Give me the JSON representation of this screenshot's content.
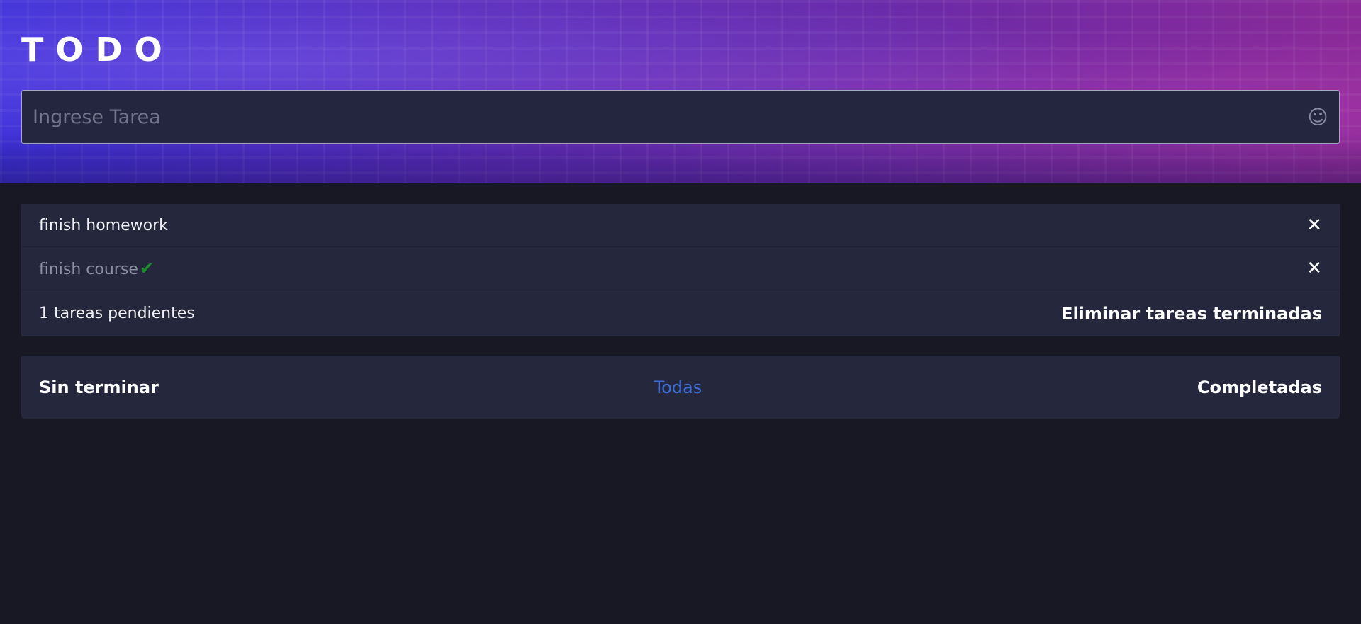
{
  "header": {
    "title": "TODO",
    "input_placeholder": "Ingrese Tarea",
    "emoji_icon": "smile-icon"
  },
  "todos": [
    {
      "text": "finish homework",
      "completed": false
    },
    {
      "text": "finish course",
      "completed": true
    }
  ],
  "footer": {
    "pending_text": "1 tareas pendientes",
    "clear_label": "Eliminar tareas terminadas"
  },
  "filters": {
    "unfinished": "Sin terminar",
    "all": "Todas",
    "completed": "Completadas",
    "active": "all"
  },
  "colors": {
    "background": "#181824",
    "card": "#25273d",
    "accent": "#3a6fd8",
    "check": "#1c8f2c"
  }
}
